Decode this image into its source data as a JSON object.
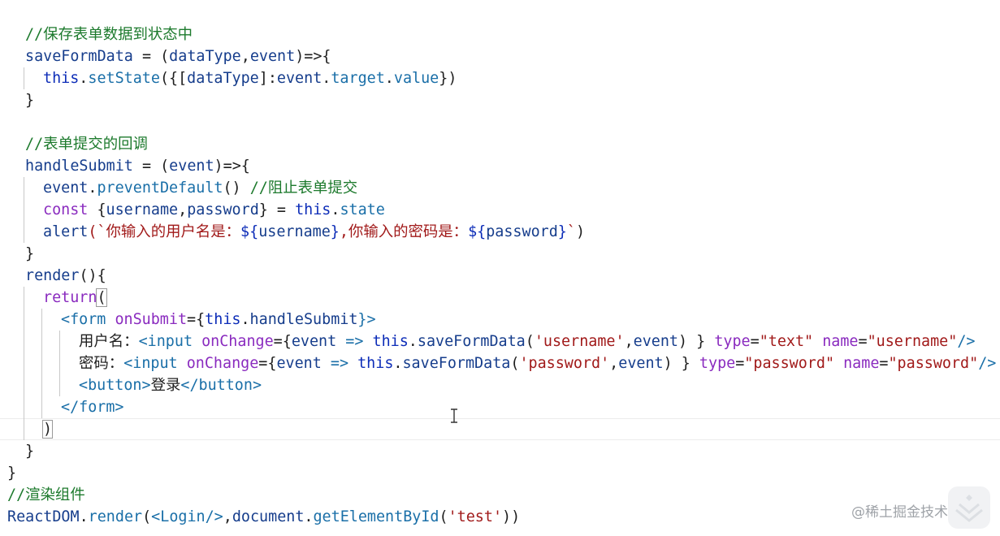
{
  "editor": {
    "lines": [
      {
        "indent": 1,
        "tokens": [
          {
            "t": "//保存表单数据到状态中",
            "k": "c"
          }
        ]
      },
      {
        "indent": 1,
        "tokens": [
          {
            "t": "saveFormData",
            "k": "v"
          },
          {
            "t": " = (",
            "k": "pl"
          },
          {
            "t": "dataType",
            "k": "v"
          },
          {
            "t": ",",
            "k": "pl"
          },
          {
            "t": "event",
            "k": "v"
          },
          {
            "t": ")=>{",
            "k": "pl"
          }
        ]
      },
      {
        "indent": 2,
        "tokens": [
          {
            "t": "this",
            "k": "t"
          },
          {
            "t": ".",
            "k": "pl"
          },
          {
            "t": "setState",
            "k": "p"
          },
          {
            "t": "({[",
            "k": "pl"
          },
          {
            "t": "dataType",
            "k": "v"
          },
          {
            "t": "]:",
            "k": "pl"
          },
          {
            "t": "event",
            "k": "v"
          },
          {
            "t": ".",
            "k": "pl"
          },
          {
            "t": "target",
            "k": "p"
          },
          {
            "t": ".",
            "k": "pl"
          },
          {
            "t": "value",
            "k": "p"
          },
          {
            "t": "})",
            "k": "pl"
          }
        ]
      },
      {
        "indent": 1,
        "tokens": [
          {
            "t": "}",
            "k": "pl"
          }
        ]
      },
      {
        "indent": 0,
        "tokens": []
      },
      {
        "indent": 1,
        "tokens": [
          {
            "t": "//表单提交的回调",
            "k": "c"
          }
        ]
      },
      {
        "indent": 1,
        "tokens": [
          {
            "t": "handleSubmit",
            "k": "v"
          },
          {
            "t": " = (",
            "k": "pl"
          },
          {
            "t": "event",
            "k": "v"
          },
          {
            "t": ")=>{",
            "k": "pl"
          }
        ]
      },
      {
        "indent": 2,
        "tokens": [
          {
            "t": "event",
            "k": "v"
          },
          {
            "t": ".",
            "k": "pl"
          },
          {
            "t": "preventDefault",
            "k": "p"
          },
          {
            "t": "() ",
            "k": "pl"
          },
          {
            "t": "//阻止表单提交",
            "k": "c"
          }
        ]
      },
      {
        "indent": 2,
        "tokens": [
          {
            "t": "const",
            "k": "k"
          },
          {
            "t": " {",
            "k": "pl"
          },
          {
            "t": "username",
            "k": "v"
          },
          {
            "t": ",",
            "k": "pl"
          },
          {
            "t": "password",
            "k": "v"
          },
          {
            "t": "} = ",
            "k": "pl"
          },
          {
            "t": "this",
            "k": "t"
          },
          {
            "t": ".",
            "k": "pl"
          },
          {
            "t": "state",
            "k": "p"
          }
        ]
      },
      {
        "indent": 2,
        "tokens": [
          {
            "t": "alert",
            "k": "v"
          },
          {
            "t": "(`你输入的用户名是：",
            "k": "s"
          },
          {
            "t": "${",
            "k": "t"
          },
          {
            "t": "username",
            "k": "v"
          },
          {
            "t": "}",
            "k": "t"
          },
          {
            "t": ",你输入的密码是：",
            "k": "s"
          },
          {
            "t": "${",
            "k": "t"
          },
          {
            "t": "password",
            "k": "v"
          },
          {
            "t": "}",
            "k": "t"
          },
          {
            "t": "`",
            "k": "s"
          },
          {
            "t": ")",
            "k": "pl"
          }
        ]
      },
      {
        "indent": 1,
        "tokens": [
          {
            "t": "}",
            "k": "pl"
          }
        ]
      },
      {
        "indent": 1,
        "tokens": [
          {
            "t": "render",
            "k": "v"
          },
          {
            "t": "(){",
            "k": "pl"
          }
        ]
      },
      {
        "indent": 2,
        "tokens": [
          {
            "t": "return",
            "k": "k"
          },
          {
            "t": "(",
            "k": "pl",
            "b": true
          }
        ]
      },
      {
        "indent": 3,
        "tokens": [
          {
            "t": "<form ",
            "k": "p"
          },
          {
            "t": "onSubmit",
            "k": "k"
          },
          {
            "t": "={",
            "k": "pl"
          },
          {
            "t": "this",
            "k": "t"
          },
          {
            "t": ".",
            "k": "pl"
          },
          {
            "t": "handleSubmit",
            "k": "v"
          },
          {
            "t": "}>",
            "k": "p"
          }
        ]
      },
      {
        "indent": 4,
        "tokens": [
          {
            "t": "用户名：",
            "k": "pl"
          },
          {
            "t": "<input ",
            "k": "p"
          },
          {
            "t": "onChange",
            "k": "k"
          },
          {
            "t": "={",
            "k": "pl"
          },
          {
            "t": "event",
            "k": "v"
          },
          {
            "t": " => ",
            "k": "p"
          },
          {
            "t": "this",
            "k": "t"
          },
          {
            "t": ".",
            "k": "pl"
          },
          {
            "t": "saveFormData",
            "k": "v"
          },
          {
            "t": "(",
            "k": "pl"
          },
          {
            "t": "'username'",
            "k": "s"
          },
          {
            "t": ",",
            "k": "pl"
          },
          {
            "t": "event",
            "k": "v"
          },
          {
            "t": ") } ",
            "k": "pl"
          },
          {
            "t": "type",
            "k": "k"
          },
          {
            "t": "=",
            "k": "pl"
          },
          {
            "t": "\"text\"",
            "k": "s"
          },
          {
            "t": " ",
            "k": "pl"
          },
          {
            "t": "name",
            "k": "k"
          },
          {
            "t": "=",
            "k": "pl"
          },
          {
            "t": "\"username\"",
            "k": "s"
          },
          {
            "t": "/>",
            "k": "p"
          }
        ]
      },
      {
        "indent": 4,
        "tokens": [
          {
            "t": "密码：",
            "k": "pl"
          },
          {
            "t": "<input ",
            "k": "p"
          },
          {
            "t": "onChange",
            "k": "k"
          },
          {
            "t": "={",
            "k": "pl"
          },
          {
            "t": "event",
            "k": "v"
          },
          {
            "t": " => ",
            "k": "p"
          },
          {
            "t": "this",
            "k": "t"
          },
          {
            "t": ".",
            "k": "pl"
          },
          {
            "t": "saveFormData",
            "k": "v"
          },
          {
            "t": "(",
            "k": "pl"
          },
          {
            "t": "'password'",
            "k": "s"
          },
          {
            "t": ",",
            "k": "pl"
          },
          {
            "t": "event",
            "k": "v"
          },
          {
            "t": ") } ",
            "k": "pl"
          },
          {
            "t": "type",
            "k": "k"
          },
          {
            "t": "=",
            "k": "pl"
          },
          {
            "t": "\"password\"",
            "k": "s"
          },
          {
            "t": " ",
            "k": "pl"
          },
          {
            "t": "name",
            "k": "k"
          },
          {
            "t": "=",
            "k": "pl"
          },
          {
            "t": "\"password\"",
            "k": "s"
          },
          {
            "t": "/>",
            "k": "p"
          }
        ]
      },
      {
        "indent": 4,
        "tokens": [
          {
            "t": "<button>",
            "k": "p"
          },
          {
            "t": "登录",
            "k": "pl"
          },
          {
            "t": "</button>",
            "k": "p"
          }
        ]
      },
      {
        "indent": 3,
        "tokens": [
          {
            "t": "</form>",
            "k": "p"
          }
        ]
      },
      {
        "indent": 2,
        "tokens": [
          {
            "t": ")",
            "k": "pl",
            "b": true
          }
        ]
      },
      {
        "indent": 1,
        "tokens": [
          {
            "t": "}",
            "k": "pl"
          }
        ]
      },
      {
        "indent": 0,
        "tokens": [
          {
            "t": "}",
            "k": "pl"
          }
        ]
      },
      {
        "indent": 0,
        "tokens": [
          {
            "t": "//渲染组件",
            "k": "c"
          }
        ]
      },
      {
        "indent": 0,
        "tokens": [
          {
            "t": "ReactDOM",
            "k": "v"
          },
          {
            "t": ".",
            "k": "pl"
          },
          {
            "t": "render",
            "k": "p"
          },
          {
            "t": "(",
            "k": "pl"
          },
          {
            "t": "<Login/>",
            "k": "p"
          },
          {
            "t": ",",
            "k": "pl"
          },
          {
            "t": "document",
            "k": "v"
          },
          {
            "t": ".",
            "k": "pl"
          },
          {
            "t": "getElementById",
            "k": "p"
          },
          {
            "t": "(",
            "k": "pl"
          },
          {
            "t": "'test'",
            "k": "s"
          },
          {
            "t": "))",
            "k": "pl"
          }
        ]
      }
    ]
  },
  "watermark": {
    "text": "@稀土掘金技术社区"
  },
  "icons": {
    "cursor": "text-cursor-icon",
    "logo": "juejin-logo-icon"
  },
  "colors": {
    "comment": "#1d7a2d",
    "keyword": "#8a2bbf",
    "this": "#0d2db8",
    "property": "#1a6fa8",
    "string": "#a11a1a",
    "variable": "#163d8c"
  }
}
